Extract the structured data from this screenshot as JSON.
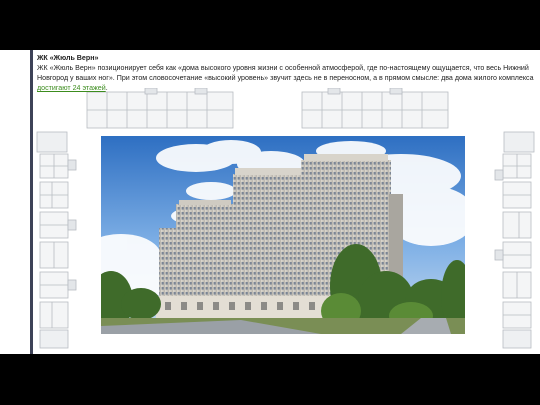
{
  "slide": {
    "heading": "ЖК «Жюль Верн»",
    "body_before": "ЖК «Жюль Верн» позиционирует себя как «дома высокого уровня жизни с особенной атмосферой, где по-настоящему ощущается, что весь Нижний Новгород у ваших ног». При этом словосочетание «высокий уровень» звучит здесь не в переносном, а в прямом смысле: два дома жилого комплекса ",
    "body_highlight": "достигают 24 этажей",
    "body_after": "."
  },
  "colors": {
    "slide_background": "#ffffff",
    "accent_bar": "#3d4257",
    "highlight": "#3c8c1e"
  }
}
